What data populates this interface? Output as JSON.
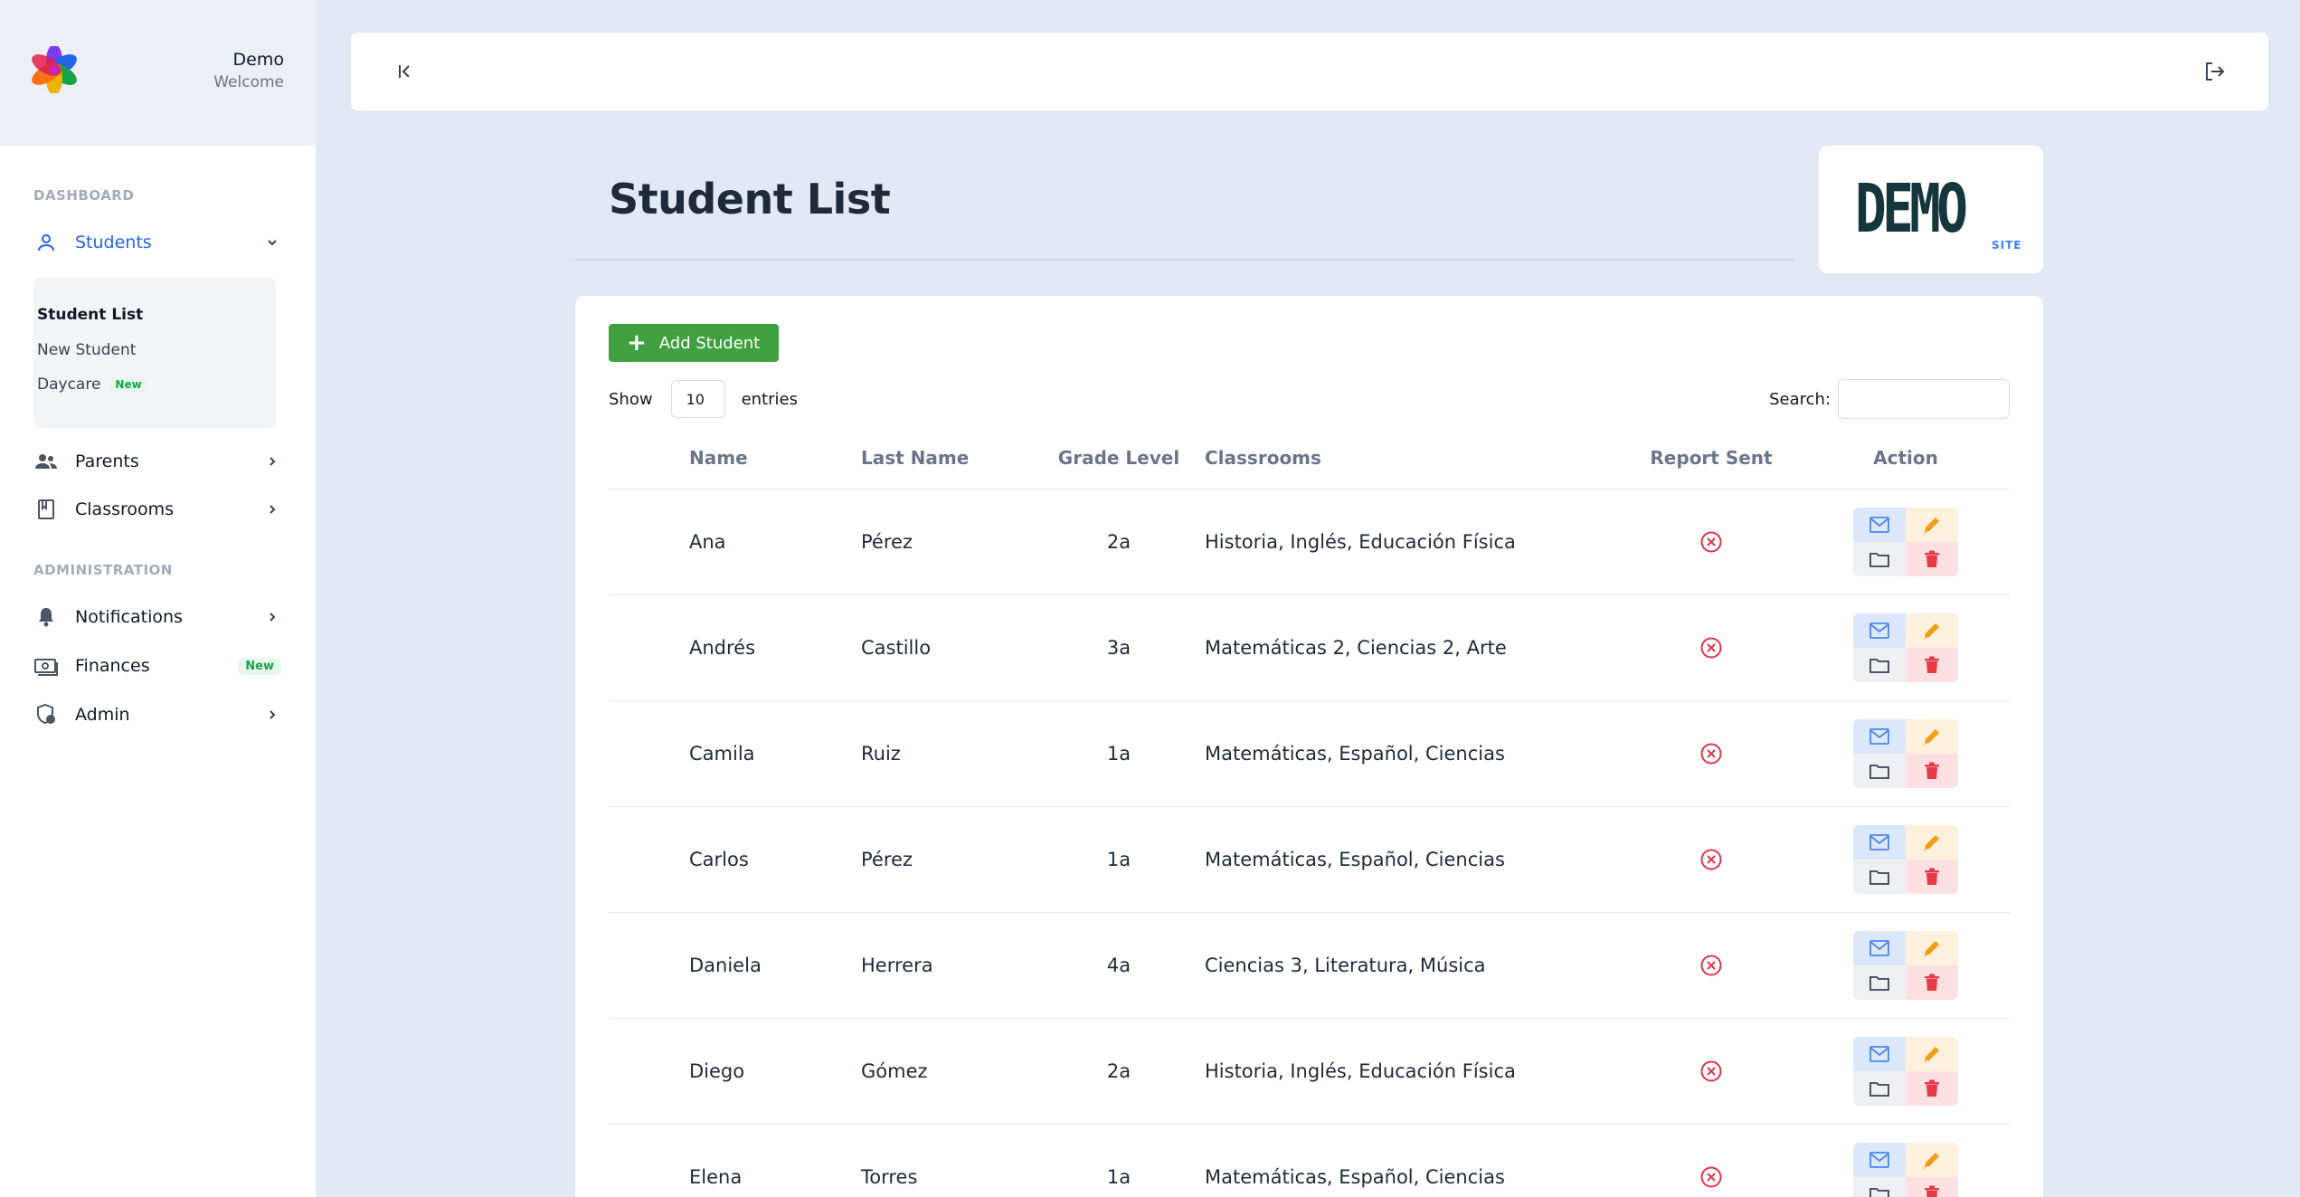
{
  "sidebar": {
    "user": {
      "name": "Demo",
      "subtitle": "Welcome"
    },
    "sections": {
      "dashboard": "DASHBOARD",
      "administration": "ADMINISTRATION"
    },
    "items": {
      "students": "Students",
      "parents": "Parents",
      "classrooms": "Classrooms",
      "notifications": "Notifications",
      "finances": "Finances",
      "admin": "Admin"
    },
    "finances_badge": "New",
    "submenu": {
      "student_list": "Student List",
      "new_student": "New Student",
      "daycare": "Daycare",
      "daycare_badge": "New"
    }
  },
  "page": {
    "title": "Student List",
    "brand": {
      "main": "DEMO",
      "sub": "SITE"
    }
  },
  "toolbar": {
    "add_label": "Add Student",
    "show_label": "Show",
    "entries_value": "10",
    "entries_label": "entries",
    "search_label": "Search:"
  },
  "table": {
    "headers": [
      "Name",
      "Last Name",
      "Grade Level",
      "Classrooms",
      "Report Sent",
      "Action"
    ],
    "rows": [
      {
        "name": "Ana",
        "last": "Pérez",
        "grade": "2a",
        "classrooms": "Historia, Inglés, Educación Física"
      },
      {
        "name": "Andrés",
        "last": "Castillo",
        "grade": "3a",
        "classrooms": "Matemáticas 2, Ciencias 2, Arte"
      },
      {
        "name": "Camila",
        "last": "Ruiz",
        "grade": "1a",
        "classrooms": "Matemáticas, Español, Ciencias"
      },
      {
        "name": "Carlos",
        "last": "Pérez",
        "grade": "1a",
        "classrooms": "Matemáticas, Español, Ciencias"
      },
      {
        "name": "Daniela",
        "last": "Herrera",
        "grade": "4a",
        "classrooms": "Ciencias 3, Literatura, Música"
      },
      {
        "name": "Diego",
        "last": "Gómez",
        "grade": "2a",
        "classrooms": "Historia, Inglés, Educación Física"
      },
      {
        "name": "Elena",
        "last": "Torres",
        "grade": "1a",
        "classrooms": "Matemáticas, Español, Ciencias"
      }
    ]
  },
  "colors": {
    "accent": "#2563eb",
    "add_button": "#3fa03f",
    "report_not_sent": "#e0344b",
    "new_badge": "#16a34a"
  }
}
